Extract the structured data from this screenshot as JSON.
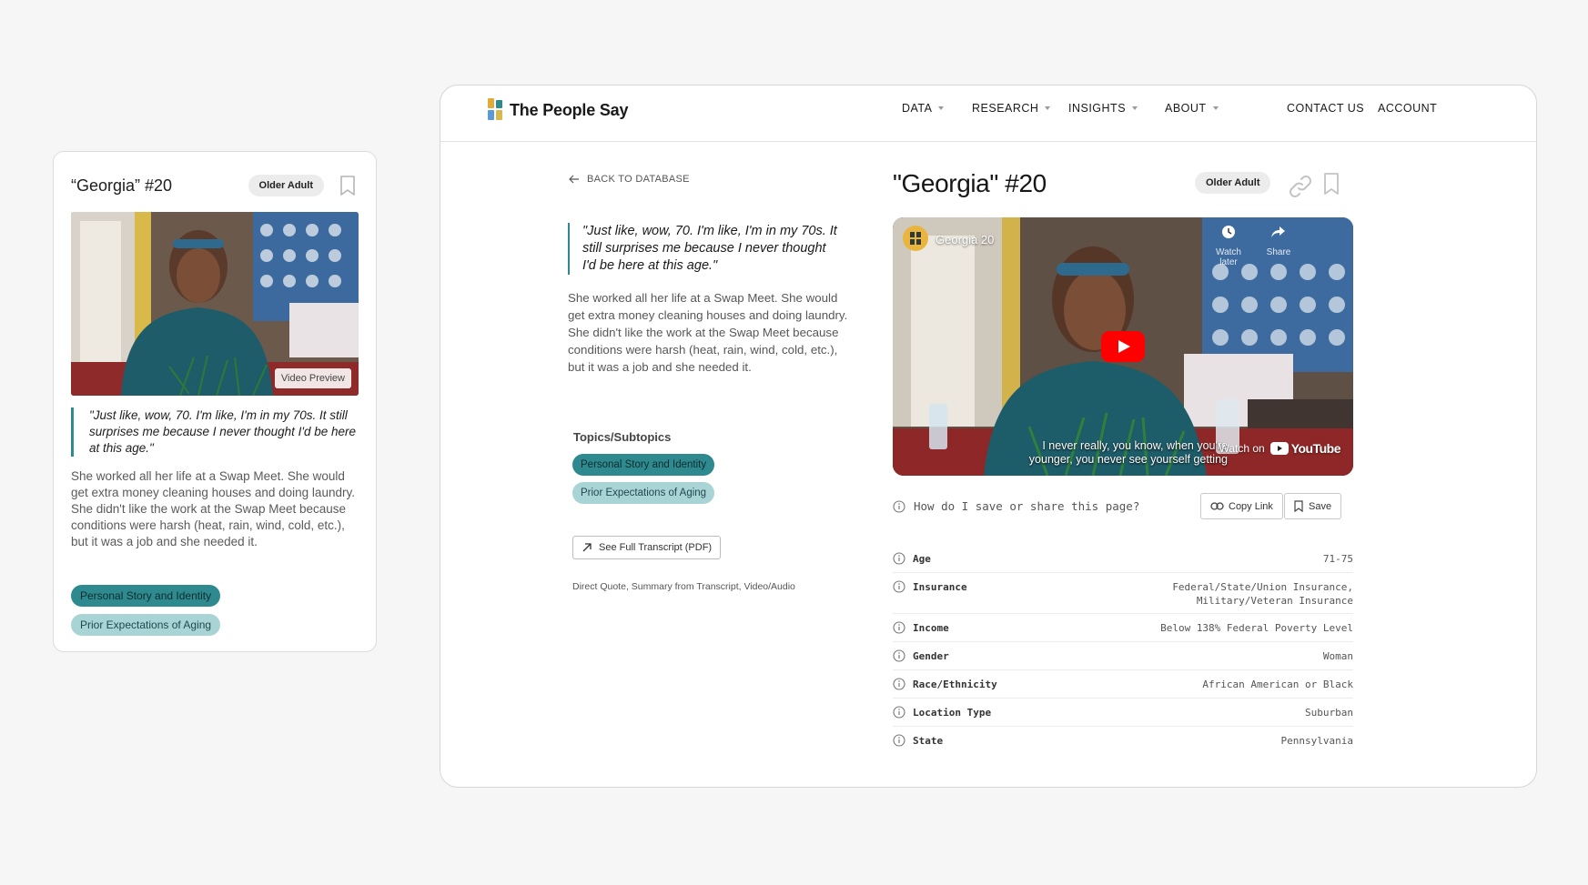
{
  "card": {
    "title": "“Georgia” #20",
    "badge": "Older Adult",
    "preview_label": "Video Preview",
    "quote": "\"Just like, wow, 70. I'm like, I'm in my 70s. It still surprises me because I never thought I'd be here at this age.\"",
    "summary": "She worked all her life at a Swap Meet. She would get extra money cleaning houses and doing laundry. She didn't like the work at the Swap Meet because conditions were harsh (heat, rain, wind, cold, etc.), but it was a job and she needed it.",
    "tags": [
      "Personal Story and Identity",
      "Prior Expectations of Aging"
    ]
  },
  "nav": {
    "brand": "The People Say",
    "items": [
      {
        "label": "DATA",
        "dropdown": true
      },
      {
        "label": "RESEARCH",
        "dropdown": true
      },
      {
        "label": "INSIGHTS",
        "dropdown": true
      },
      {
        "label": "ABOUT",
        "dropdown": true
      },
      {
        "label": "CONTACT US",
        "dropdown": false
      },
      {
        "label": "ACCOUNT",
        "dropdown": false
      }
    ]
  },
  "detail": {
    "back_label": "BACK TO DATABASE",
    "title": "\"Georgia\" #20",
    "badge": "Older Adult",
    "quote": "\"Just like, wow, 70. I'm like, I'm in my 70s. It still surprises me because I never thought I'd be here at this age.\"",
    "summary": "She worked all her life at a Swap Meet. She would get extra money cleaning houses and doing laundry. She didn't like the work at the Swap Meet because conditions were harsh (heat, rain, wind, cold, etc.), but it was a job and she needed it.",
    "topics_label": "Topics/Subtopics",
    "tags": [
      "Personal Story and Identity",
      "Prior Expectations of Aging"
    ],
    "transcript_button": "See Full Transcript (PDF)",
    "sources": "Direct Quote, Summary from Transcript, Video/Audio",
    "video": {
      "title": "Georgia 20",
      "watch_later": "Watch later",
      "share": "Share",
      "caption_line1": "I never really, you know, when you're",
      "caption_line2": "younger, you never see yourself getting",
      "watch_on": "Watch on",
      "platform": "YouTube"
    },
    "help_question": "How do I save or share this page?",
    "copy_link": "Copy Link",
    "save": "Save",
    "facts": [
      {
        "key": "Age",
        "value": "71-75"
      },
      {
        "key": "Insurance",
        "value": "Federal/State/Union Insurance, Military/Veteran Insurance"
      },
      {
        "key": "Income",
        "value": "Below 138% Federal Poverty Level"
      },
      {
        "key": "Gender",
        "value": "Woman"
      },
      {
        "key": "Race/Ethnicity",
        "value": "African American or Black"
      },
      {
        "key": "Location Type",
        "value": "Suburban"
      },
      {
        "key": "State",
        "value": "Pennsylvania"
      }
    ]
  },
  "colors": {
    "accent_teal": "#2e8a8f",
    "accent_teal_light": "#a9d4d5",
    "youtube_red": "#ff0000"
  }
}
